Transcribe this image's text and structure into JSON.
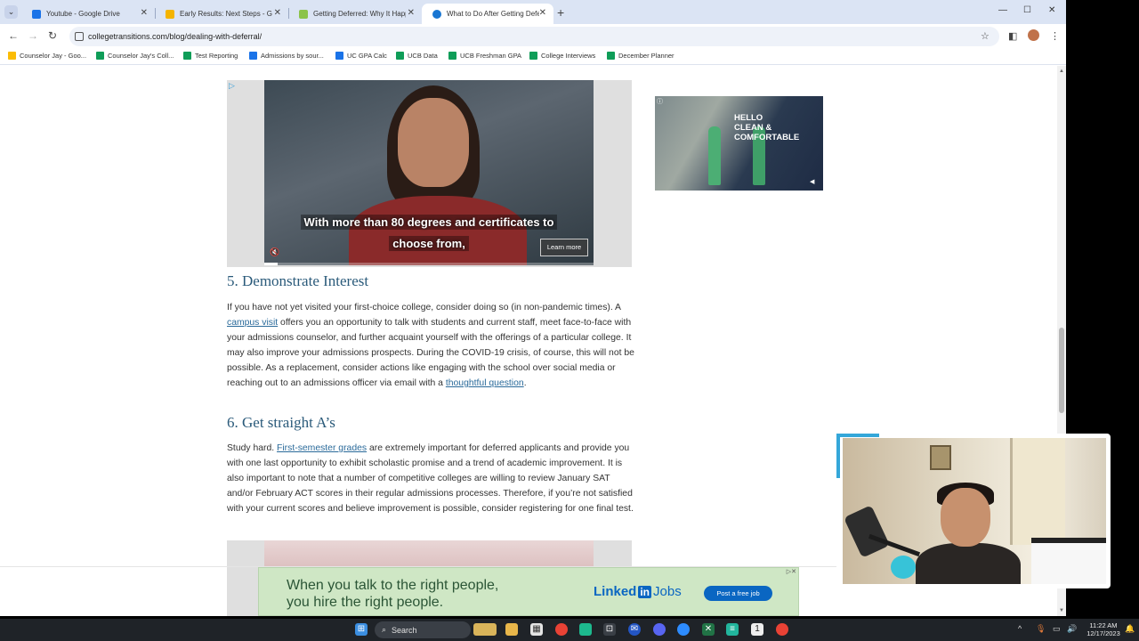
{
  "browser": {
    "tabs": [
      {
        "title": "Youtube - Google Drive",
        "favicon_color": "#1a73e8",
        "active": false
      },
      {
        "title": "Early Results: Next Steps - Goog",
        "favicon_color": "#f4b400",
        "active": false
      },
      {
        "title": "Getting Deferred: Why It Happe",
        "favicon_color": "#8bc34a",
        "active": false
      },
      {
        "title": "What to Do After Getting Defer",
        "favicon_color": "#1976d2",
        "active": true
      }
    ],
    "url": "collegetransitions.com/blog/dealing-with-deferral/",
    "bookmarks": [
      {
        "label": "Counselor Jay - Goo...",
        "icon_color": "#fbbc04"
      },
      {
        "label": "Counselor Jay's Coll...",
        "icon_color": "#0f9d58"
      },
      {
        "label": "Test Reporting",
        "icon_color": "#0f9d58"
      },
      {
        "label": "Admissions by sour...",
        "icon_color": "#1a73e8"
      },
      {
        "label": "UC GPA Calc",
        "icon_color": "#1a73e8"
      },
      {
        "label": "UCB Data",
        "icon_color": "#0f9d58"
      },
      {
        "label": "UCB Freshman GPA",
        "icon_color": "#0f9d58"
      },
      {
        "label": "College Interviews",
        "icon_color": "#0f9d58"
      },
      {
        "label": "December Planner",
        "icon_color": "#0f9d58"
      }
    ]
  },
  "article": {
    "video_ad": {
      "caption_line1": "With more than 80 degrees and certificates to",
      "caption_line2": "choose from,",
      "learn_more": "Learn more",
      "progress": 0.04
    },
    "side_ad": {
      "line1": "HELLO",
      "line2": "CLEAN &",
      "line3": "COMFORTABLE"
    },
    "section5": {
      "heading": "5. Demonstrate Interest",
      "p_start": "If you have not yet visited your first-choice college, consider doing so (in non-pandemic times). A ",
      "link1": "campus visit",
      "p_mid": " offers you an opportunity to talk with students and current staff, meet face-to-face with your admissions counselor, and further acquaint yourself with the offerings of a particular college. It may also improve your admissions prospects. During the COVID-19 crisis, of course, this will not be possible. As a replacement, consider actions like engaging with the school over social media or reaching out to an admissions officer via email with a ",
      "link2": "thoughtful question",
      "p_end": "."
    },
    "section6": {
      "heading": "6. Get straight A’s",
      "p_start": "Study hard. ",
      "link1": "First-semester grades",
      "p_rest": " are extremely important for deferred applicants and provide you with one last opportunity to exhibit scholastic promise and a trend of academic improvement. It is also important to note that a number of competitive colleges are willing to review January SAT and/or February ACT scores in their regular admissions processes. Therefore, if you’re not satisfied with your current scores and believe improvement is possible, consider registering for one final test."
    },
    "bottom_ad": {
      "line1": "When you talk to the right people,",
      "line2": "you hire the right people.",
      "brand_linked": "Linked",
      "brand_in": "in",
      "brand_jobs": "Jobs",
      "cta": "Post a free job"
    }
  },
  "taskbar": {
    "search": "Search",
    "time": "11:22 AM",
    "date": "12/17/2023"
  },
  "colors": {
    "accent": "#34a7d9",
    "link": "#2a6a9a",
    "heading": "#2a5a7a",
    "linkedin_blue": "#0a66c2"
  }
}
